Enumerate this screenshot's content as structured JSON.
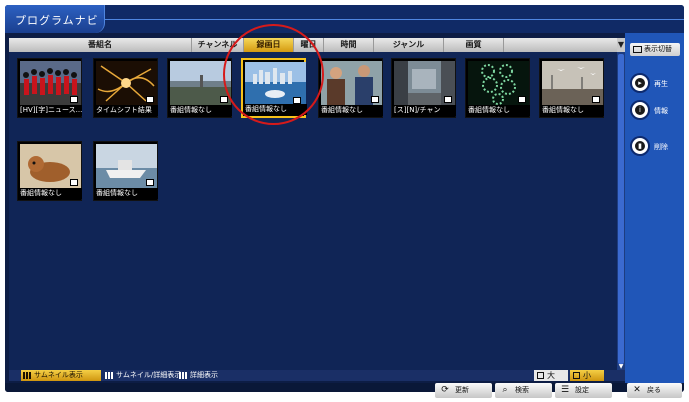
{
  "window": {
    "title": "プログラムナビ"
  },
  "columns": [
    {
      "label": "番組名",
      "active": false
    },
    {
      "label": "チャンネル",
      "active": false
    },
    {
      "label": "録画日",
      "active": true
    },
    {
      "label": "曜日",
      "active": false
    },
    {
      "label": "時間",
      "active": false
    },
    {
      "label": "ジャンル",
      "active": false
    },
    {
      "label": "画質",
      "active": false
    }
  ],
  "sort_icon": "sort-toggle-icon",
  "thumbnails": [
    {
      "caption": "[HV][字]ニュース...",
      "scene": "guards-parade",
      "selected": false
    },
    {
      "caption": "タイムシフト結果",
      "scene": "light-burst",
      "selected": false
    },
    {
      "caption": "番組情報なし",
      "scene": "waterfront",
      "selected": false
    },
    {
      "caption": "番組情報なし",
      "scene": "harbor-city",
      "selected": true
    },
    {
      "caption": "番組情報なし",
      "scene": "two-people",
      "selected": false
    },
    {
      "caption": "[ス][N]/チャン",
      "scene": "city-street",
      "selected": false
    },
    {
      "caption": "番組情報なし",
      "scene": "spiral-dots",
      "selected": false
    },
    {
      "caption": "番組情報なし",
      "scene": "seagulls-pier",
      "selected": false
    },
    {
      "caption": "番組情報なし",
      "scene": "animal",
      "selected": false
    },
    {
      "caption": "番組情報なし",
      "scene": "boat-sea",
      "selected": false
    }
  ],
  "view_modes": [
    {
      "label": "サムネイル表示",
      "active": true
    },
    {
      "label": "サムネイル/詳細表示",
      "active": false
    },
    {
      "label": "詳細表示",
      "active": false
    }
  ],
  "size_options": {
    "large": "大",
    "small": "小",
    "selected": "small"
  },
  "side_panel": {
    "display_switch": "表示切替",
    "play": "再生",
    "info": "情報",
    "delete": "削除"
  },
  "bottom_buttons": {
    "refresh": "更新",
    "search": "検索",
    "settings": "設定",
    "back": "戻る"
  },
  "colors": {
    "background": "#0d1d45",
    "panel": "#2056b8",
    "accent": "#f6c21a",
    "highlight_ring": "#d61a1a"
  }
}
